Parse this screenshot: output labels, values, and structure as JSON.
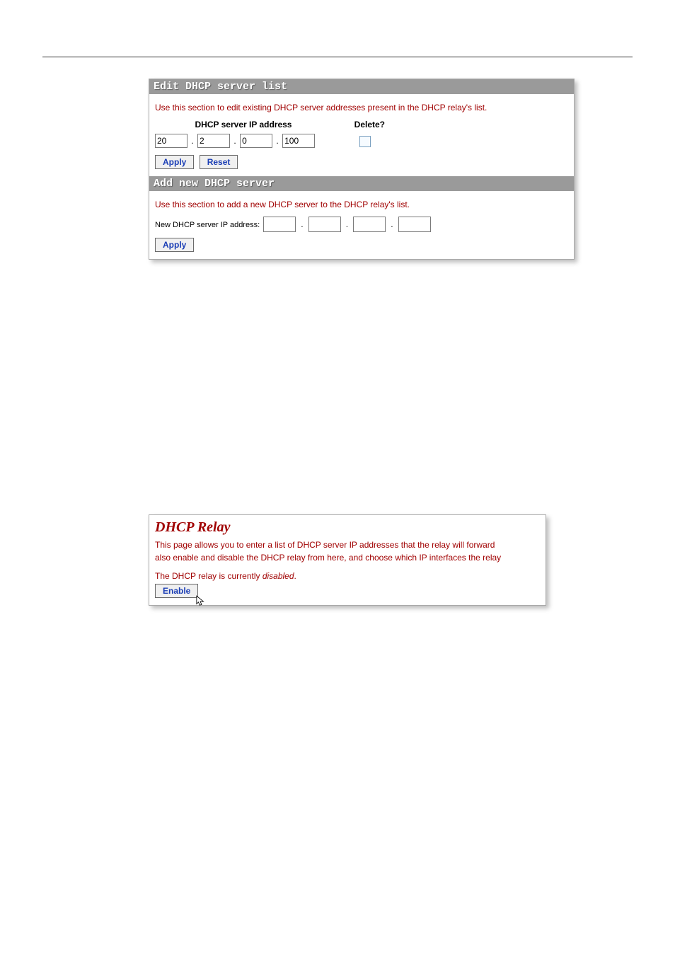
{
  "edit_section": {
    "header": "Edit DHCP server list",
    "description": "Use this section to edit existing DHCP server addresses present in the DHCP relay's list.",
    "col_ip": "DHCP server IP address",
    "col_delete": "Delete?",
    "ip": {
      "o1": "20",
      "o2": "2",
      "o3": "0",
      "o4": "100"
    },
    "apply_label": "Apply",
    "reset_label": "Reset"
  },
  "add_section": {
    "header": "Add new DHCP server",
    "description": "Use this section to add a new DHCP server to the DHCP relay's list.",
    "field_label": "New DHCP server IP address:",
    "apply_label": "Apply"
  },
  "relay_panel": {
    "title": "DHCP Relay",
    "desc_line1": "This page allows you to enter a list of DHCP server IP addresses that the relay will forward",
    "desc_line2": "also enable and disable the DHCP relay from here, and choose which IP interfaces the relay",
    "status_prefix": "The DHCP relay is currently ",
    "status_value": "disabled",
    "status_suffix": ".",
    "enable_label": "Enable"
  }
}
